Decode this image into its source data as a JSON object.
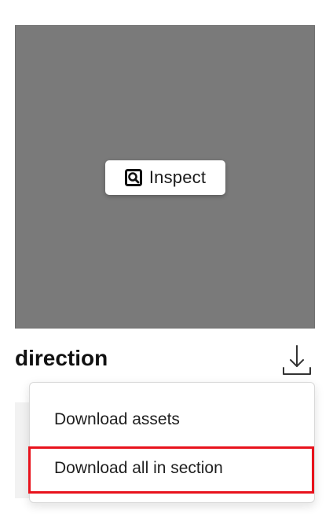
{
  "preview": {
    "inspect_label": "Inspect",
    "inspect_icon": "inspect-icon"
  },
  "asset": {
    "name": "direction",
    "download_icon": "download-icon"
  },
  "menu": {
    "items": [
      {
        "label": "Download assets"
      },
      {
        "label": "Download all in section"
      }
    ]
  },
  "colors": {
    "preview_bg": "#7a7a7a",
    "highlight": "#e8121c"
  }
}
